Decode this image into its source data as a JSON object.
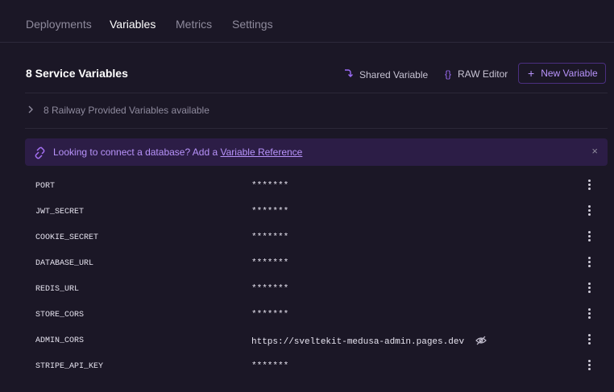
{
  "tabs": [
    {
      "label": "Deployments"
    },
    {
      "label": "Variables"
    },
    {
      "label": "Metrics"
    },
    {
      "label": "Settings"
    }
  ],
  "active_tab": "Variables",
  "section": {
    "title": "8 Service Variables",
    "shared_variable_label": "Shared Variable",
    "raw_editor_label": "RAW Editor",
    "raw_editor_icon": "{}",
    "new_variable_label": "New Variable",
    "new_variable_icon": "+",
    "provided_label": "8 Railway Provided Variables available"
  },
  "banner": {
    "text": "Looking to connect a database? Add a ",
    "link": "Variable Reference",
    "close_icon": "×"
  },
  "variables": [
    {
      "name": "PORT",
      "value": "*******"
    },
    {
      "name": "JWT_SECRET",
      "value": "*******"
    },
    {
      "name": "COOKIE_SECRET",
      "value": "*******"
    },
    {
      "name": "DATABASE_URL",
      "value": "*******"
    },
    {
      "name": "REDIS_URL",
      "value": "*******"
    },
    {
      "name": "STORE_CORS",
      "value": "*******"
    },
    {
      "name": "ADMIN_CORS",
      "value": "https://sveltekit-medusa-admin.pages.dev"
    },
    {
      "name": "STRIPE_API_KEY",
      "value": "*******"
    }
  ],
  "colors": {
    "background": "#1b1726",
    "accent": "#9b6cf5",
    "banner_bg": "#2c1d46"
  }
}
